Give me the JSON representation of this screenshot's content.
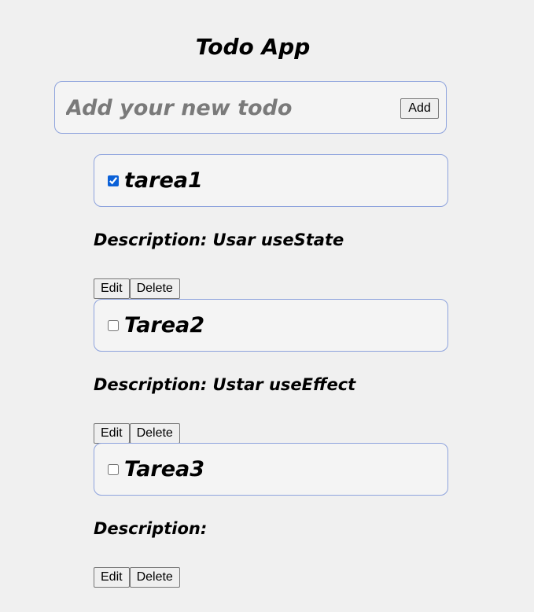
{
  "app": {
    "title": "Todo App"
  },
  "new_todo": {
    "placeholder": "Add your new todo",
    "value": "",
    "add_label": "Add"
  },
  "todos": [
    {
      "title": "tarea1",
      "checked": true,
      "description_label": "Description:",
      "description": "Usar useState",
      "edit_label": "Edit",
      "delete_label": "Delete"
    },
    {
      "title": "Tarea2",
      "checked": false,
      "description_label": "Description:",
      "description": "Ustar useEffect",
      "edit_label": "Edit",
      "delete_label": "Delete"
    },
    {
      "title": "Tarea3",
      "checked": false,
      "description_label": "Description:",
      "description": "",
      "edit_label": "Edit",
      "delete_label": "Delete"
    }
  ],
  "colors": {
    "background": "#f0f0f0",
    "card_background": "#f4f4f4",
    "card_border": "#8ea3dd",
    "checkbox_accent": "#0b61d8"
  }
}
